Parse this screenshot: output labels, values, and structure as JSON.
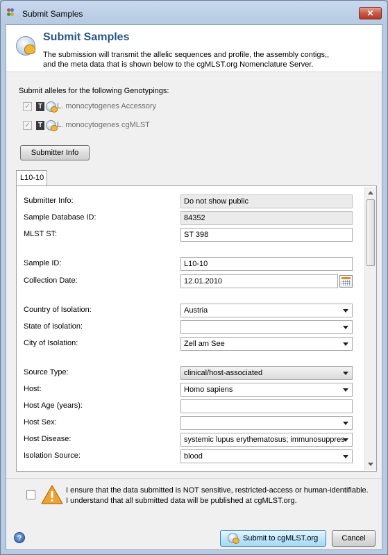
{
  "window": {
    "title": "Submit Samples",
    "close_label": "✕"
  },
  "header": {
    "title": "Submit Samples",
    "description": "The submission will transmit the allelic sequences and profile, the assembly contigs,, and the meta data that is shown below to the cgMLST.org Nomenclature Server."
  },
  "genotypings": {
    "label": "Submit alleles for the following Genotypings:",
    "items": [
      {
        "label": "L. monocytogenes Accessory",
        "checked": true,
        "enabled": false
      },
      {
        "label": "L. monocytogenes cgMLST",
        "checked": true,
        "enabled": false
      }
    ]
  },
  "submitter_button": "Submitter Info",
  "tab": {
    "label": "L10-10"
  },
  "form": {
    "submitter_info": {
      "label": "Submitter Info:",
      "value": "Do not show public"
    },
    "sample_db_id": {
      "label": "Sample Database ID:",
      "value": "84352"
    },
    "mlst_st": {
      "label": "MLST ST:",
      "value": "ST 398"
    },
    "sample_id": {
      "label": "Sample ID:",
      "value": "L10-10"
    },
    "collection_date": {
      "label": "Collection Date:",
      "value": "12.01.2010"
    },
    "country": {
      "label": "Country of Isolation:",
      "value": "Austria"
    },
    "state": {
      "label": "State of Isolation:",
      "value": ""
    },
    "city": {
      "label": "City of Isolation:",
      "value": "Zell am See"
    },
    "source_type": {
      "label": "Source Type:",
      "value": "clinical/host-associated"
    },
    "host": {
      "label": "Host:",
      "value": "Homo sapiens"
    },
    "host_age": {
      "label": "Host Age (years):",
      "value": ""
    },
    "host_sex": {
      "label": "Host Sex:",
      "value": ""
    },
    "host_disease": {
      "label": "Host Disease:",
      "value": "systemic lupus erythematosus; immunosuppres"
    },
    "isolation_source": {
      "label": "Isolation Source:",
      "value": "blood"
    }
  },
  "consent": {
    "line1": "I ensure that the data submitted is NOT sensitive, restricted-access or human-identifiable.",
    "line2": "I understand that all submitted data will be published at cgMLST.org.",
    "checked": false
  },
  "footer": {
    "help_label": "?",
    "submit_label": "Submit to cgMLST.org",
    "cancel_label": "Cancel"
  },
  "colors": {
    "header_title": "#2a5680",
    "warning": "#f0a030",
    "close_button": "#c75a46"
  }
}
